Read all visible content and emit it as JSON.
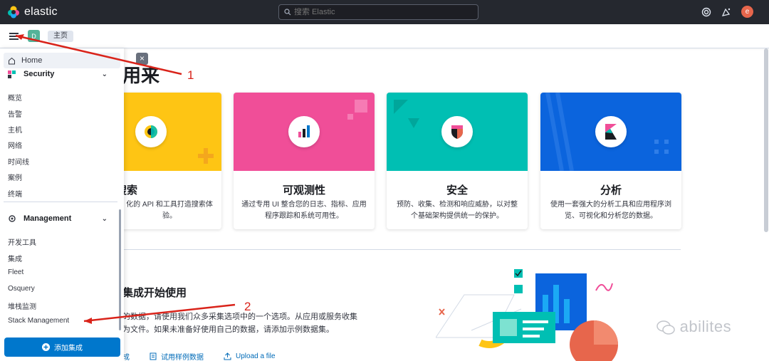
{
  "header": {
    "app_name": "elastic",
    "search_placeholder": "搜索 Elastic",
    "user_initial": "e"
  },
  "subheader": {
    "space_initial": "D",
    "breadcrumb": "主页"
  },
  "sidenav": {
    "home_label": "Home",
    "security": {
      "title": "Security",
      "items": [
        "概览",
        "告警",
        "主机",
        "网络",
        "时间线",
        "案例",
        "终端"
      ]
    },
    "management": {
      "title": "Management",
      "items": [
        "开发工具",
        "集成",
        "Fleet",
        "Osquery",
        "堆栈监测",
        "Stack Management"
      ]
    },
    "add_integration_label": "添加集成"
  },
  "main": {
    "heading_fragment": "用来",
    "cards": [
      {
        "title": "企业搜索",
        "desc": "化的 API 和工具打造搜索体验。",
        "color": "#fec514"
      },
      {
        "title": "可观测性",
        "desc": "通过专用 UI 整合您的日志、指标、应用程序跟踪和系统可用性。",
        "color": "#f04e98"
      },
      {
        "title": "安全",
        "desc": "预防、收集、检测和响应威胁，以对整个基础架构提供统一的保护。",
        "color": "#00bfb3"
      },
      {
        "title": "分析",
        "desc": "使用一套强大的分析工具和应用程序浏览、可视化和分析您的数据。",
        "color": "#0b64dd"
      }
    ],
    "integration_heading": "集成开始使用",
    "integration_text_1": "的数据，请使用我们众多采集选项中的一个选项。从应用或服务收集",
    "integration_text_2": "为文件。如果未准备好使用自己的数据，请添加示例数据集。",
    "links": {
      "add": "成",
      "sample": "试用样例数据",
      "upload": "Upload a file"
    }
  },
  "annotations": {
    "marker_1": "1",
    "marker_2": "2"
  },
  "watermark": "abilites"
}
